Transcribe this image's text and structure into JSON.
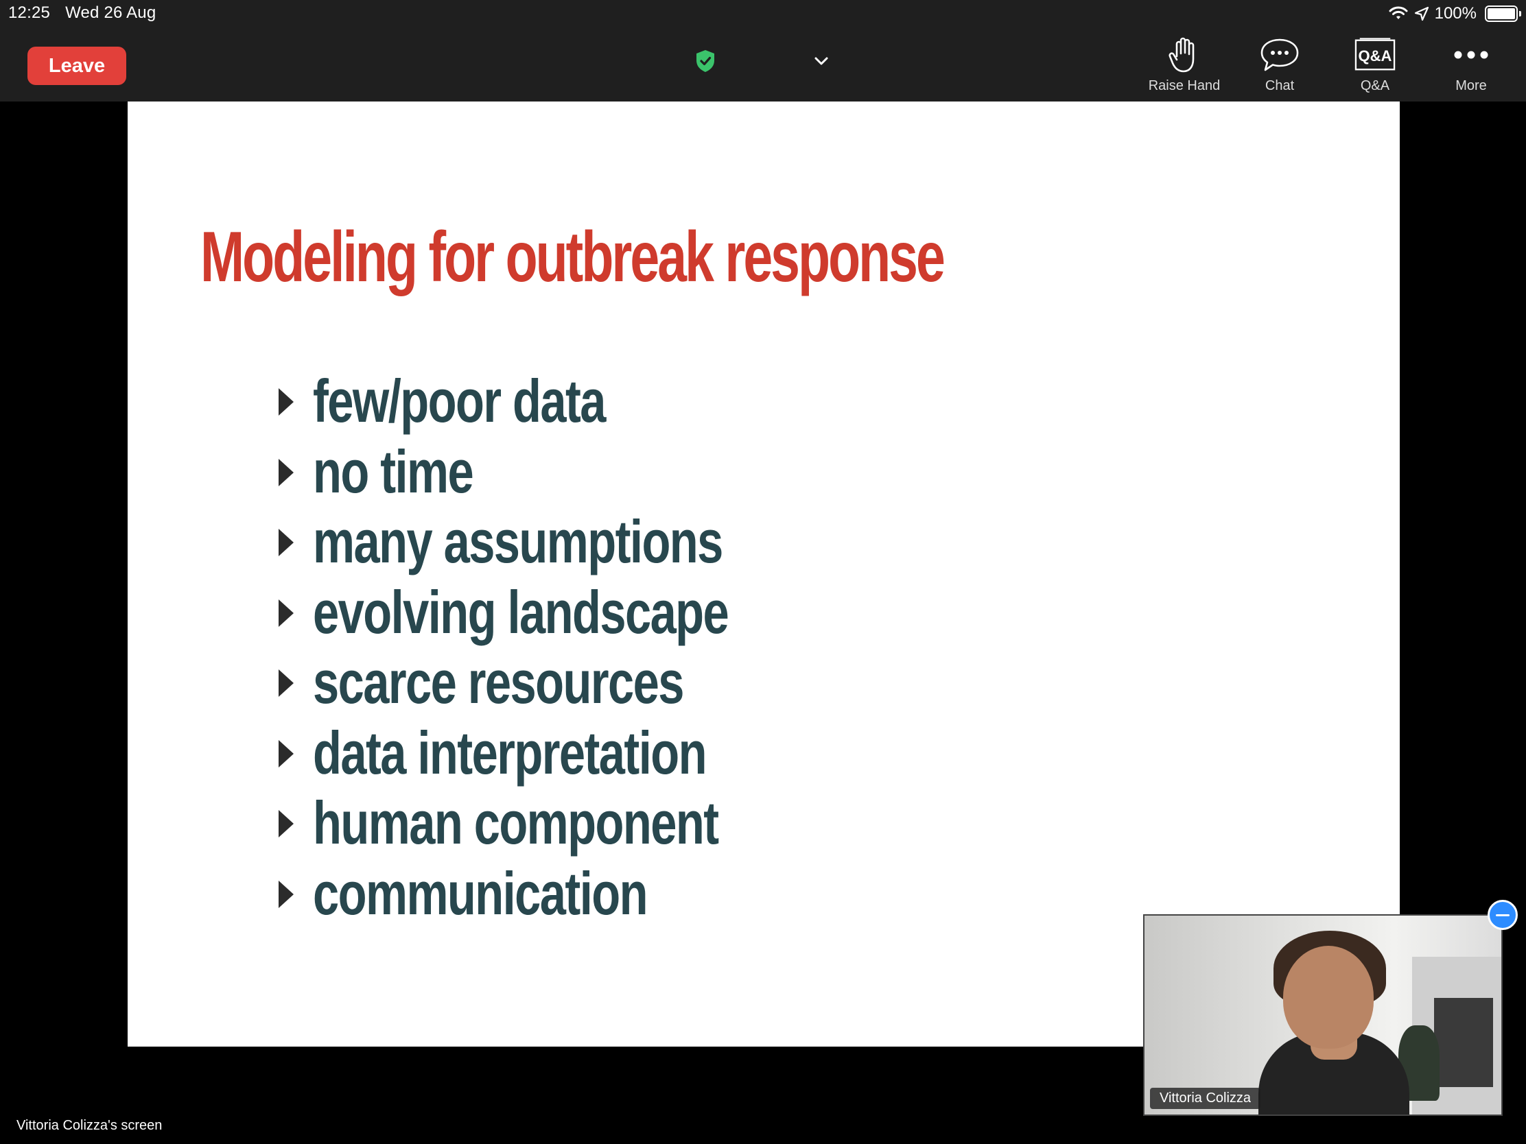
{
  "status_bar": {
    "time": "12:25",
    "date": "Wed 26 Aug",
    "battery": "100%",
    "icons": [
      "wifi-icon",
      "location-icon",
      "battery-icon"
    ]
  },
  "toolbar": {
    "leave_label": "Leave",
    "leave_color": "#e2403a",
    "buttons": [
      {
        "label": "Raise Hand",
        "icon": "raise-hand-icon"
      },
      {
        "label": "Chat",
        "icon": "chat-icon"
      },
      {
        "label": "Q&A",
        "icon": "qa-icon"
      },
      {
        "label": "More",
        "icon": "more-icon"
      }
    ],
    "security_icon": "shield-check-icon",
    "security_color": "#3bc36b"
  },
  "slide": {
    "title": "Modeling for outbreak response",
    "title_color": "#cf3b2d",
    "text_color": "#28474e",
    "bullets": [
      "few/poor data",
      "no time",
      "many assumptions",
      "evolving landscape",
      "scarce resources",
      "data interpretation",
      "human component",
      "communication"
    ]
  },
  "video": {
    "participant_name": "Vittoria Colizza"
  },
  "footer": {
    "screen_label": "Vittoria Colizza's screen"
  }
}
